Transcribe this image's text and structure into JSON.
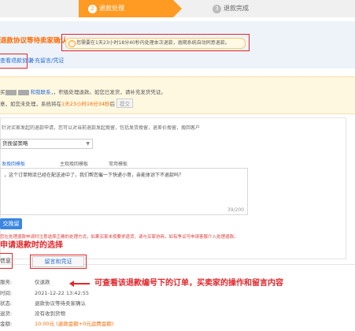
{
  "steps": {
    "active": {
      "num": "2",
      "label": "退款处理"
    },
    "next": {
      "num": "3",
      "label": "退款完成"
    }
  },
  "status": {
    "title": "退款协议等待卖家确认",
    "countdown": "您需要在1天23小时18分40秒内处理本次退款，逾期系统自动同意退款。",
    "link_protocol": "查看退款协议",
    "link_supplement": "补充留言/凭证"
  },
  "notice": {
    "line1_prefix": "买",
    "line1_suffix": "和我联系，",
    "line1_tail": "，积极处理退款。如您已发货，请补充发货凭证。",
    "line2_prefix": "意，如您未处理，系统将在",
    "line2_highlight": "1天23小时18分34秒",
    "line2_suffix": "后",
    "line2_button": "提交"
  },
  "negotiation": {
    "desc": "针对买家发起的退款申请，您可以对当前退款发起挽留，包括发货挽留，退差价挽留，挽回客户",
    "select_value": "货挽留策略",
    "template_tabs": [
      "发挽回模板",
      "主观挽回模板",
      "常用模板"
    ],
    "message": "，这个订单物流已经在配送途中了，我们帮您催一下快递小哥，亲能体谅下不退款吗？",
    "counter": "39/200",
    "submit_label": "交挽留",
    "red_note": "您在处理退款申请时注意选择正确的处理方式，如果买家未按要求退货，请与买家协商，如有争议可申请客服介入处理退款。"
  },
  "annotations": {
    "select_hint": "申请退款时的选择",
    "order_hint": "可查看该退款编号下的订单，买卖家的操作和留言内容"
  },
  "tabs": {
    "first": "信息",
    "second": "留言和凭证"
  },
  "info_rows": [
    {
      "label": "服务:",
      "value": "仅退款"
    },
    {
      "label": "时间:",
      "value": "2021-12-22 13:42:55"
    },
    {
      "label": "状态:",
      "value": "退款协议等待卖家确认"
    },
    {
      "label": "退货:",
      "value": "没有收到货物"
    },
    {
      "label": "金额:",
      "value": "10.00元 (退款金额+0元运费金额)"
    }
  ],
  "colors": {
    "accent": "#ff9a22",
    "alert": "#e4262a",
    "link": "#2a6fd6"
  }
}
